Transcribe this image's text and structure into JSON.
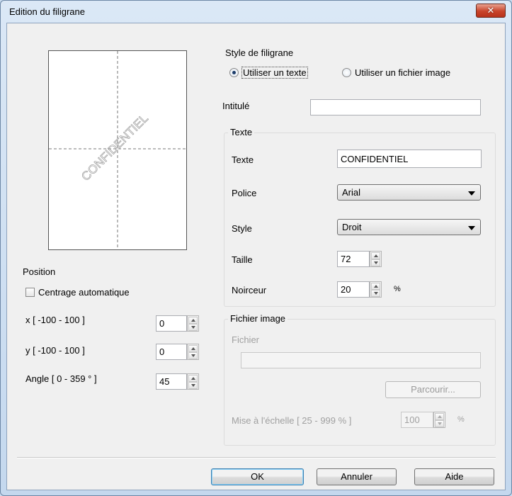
{
  "window": {
    "title": "Edition du filigrane",
    "close_glyph": "✕"
  },
  "preview": {
    "watermark_text": "CONFIDENTIEL"
  },
  "position": {
    "label": "Position",
    "auto_center": {
      "label": "Centrage automatique",
      "checked": false
    },
    "x": {
      "label": "x [ -100  -  100 ]",
      "value": "0"
    },
    "y": {
      "label": "y [ -100  -  100 ]",
      "value": "0"
    },
    "angle": {
      "label": "Angle [ 0 - 359 ° ]",
      "value": "45"
    }
  },
  "style": {
    "label": "Style de filigrane",
    "option_text": "Utiliser un texte",
    "option_image": "Utiliser un fichier image",
    "selected": "text"
  },
  "title_field": {
    "label": "Intitulé",
    "value": ""
  },
  "text_group": {
    "title": "Texte",
    "text_label": "Texte",
    "text_value": "CONFIDENTIEL",
    "font_label": "Police",
    "font_value": "Arial",
    "style_label": "Style",
    "style_value": "Droit",
    "size_label": "Taille",
    "size_value": "72",
    "darkness_label": "Noirceur",
    "darkness_value": "20",
    "percent": "%"
  },
  "image_group": {
    "title": "Fichier image",
    "file_label": "Fichier",
    "file_value": "",
    "browse_label": "Parcourir...",
    "scale_label": "Mise à l'échelle [ 25 - 999 % ]",
    "scale_value": "100",
    "percent": "%"
  },
  "buttons": {
    "ok": "OK",
    "cancel": "Annuler",
    "help": "Aide"
  },
  "colors": {
    "close_red": "#c8432a",
    "title_bar": "#dbe8f6",
    "client": "#f0f0f0"
  }
}
